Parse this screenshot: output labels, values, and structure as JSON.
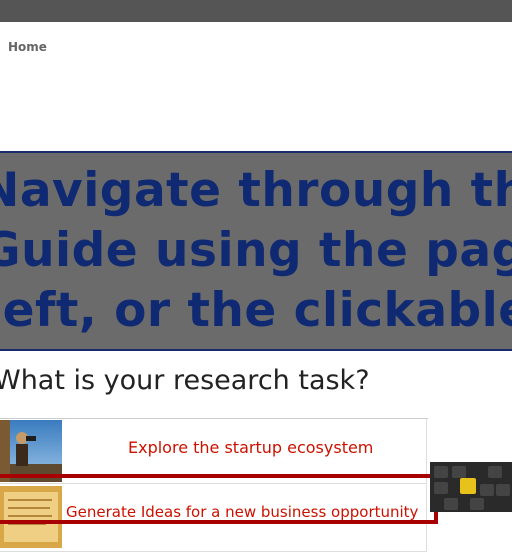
{
  "breadcrumb": {
    "home_label": "Home"
  },
  "banner": {
    "lines": [
      "Navigate through the",
      "Guide using the page",
      "left, or the clickable icons"
    ]
  },
  "research": {
    "question": "What is your research task?",
    "tasks": [
      {
        "label": "Explore the startup ecosystem",
        "image": "person-with-binoculars-photo"
      },
      {
        "label": "Generate Ideas for a new business opportunity",
        "image": "lightbulb-paper-photo"
      }
    ],
    "side_image": "keyboard-photo"
  },
  "colors": {
    "top_bar": "#555555",
    "banner_bg": "#6b6b6b",
    "banner_text": "#0f2a72",
    "link": "#cc1100",
    "highlight": "#a80000"
  }
}
